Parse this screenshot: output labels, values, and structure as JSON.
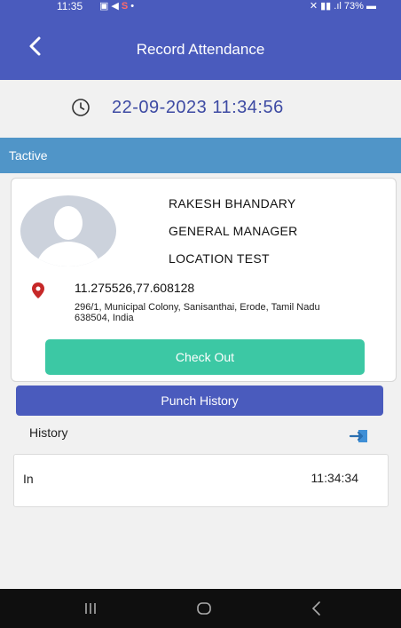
{
  "status_bar": {
    "time": "11:35",
    "battery": "73%",
    "right_text": "VoLTE 5G .ıl"
  },
  "header": {
    "title": "Record Attendance",
    "back_icon": "back-arrow-icon",
    "color": "#4a5bbd"
  },
  "datetime": "22-09-2023 11:34:56",
  "organization": "Tactive",
  "employee": {
    "name": "RAKESH BHANDARY",
    "designation": "GENERAL MANAGER",
    "location": "LOCATION TEST",
    "coordinates": "11.275526,77.608128",
    "address": "296/1, Municipal Colony, Sanisanthai, Erode, Tamil Nadu 638504, India"
  },
  "checkout_label": "Check Out",
  "punch_history": {
    "header": "Punch History",
    "history_label": "History",
    "entries": [
      {
        "type": "In",
        "time": "11:34:34"
      }
    ]
  },
  "colors": {
    "accent": "#4a5bbd",
    "org_bar": "#5095c8",
    "checkout": "#3cc8a4",
    "pin": "#c62828"
  }
}
